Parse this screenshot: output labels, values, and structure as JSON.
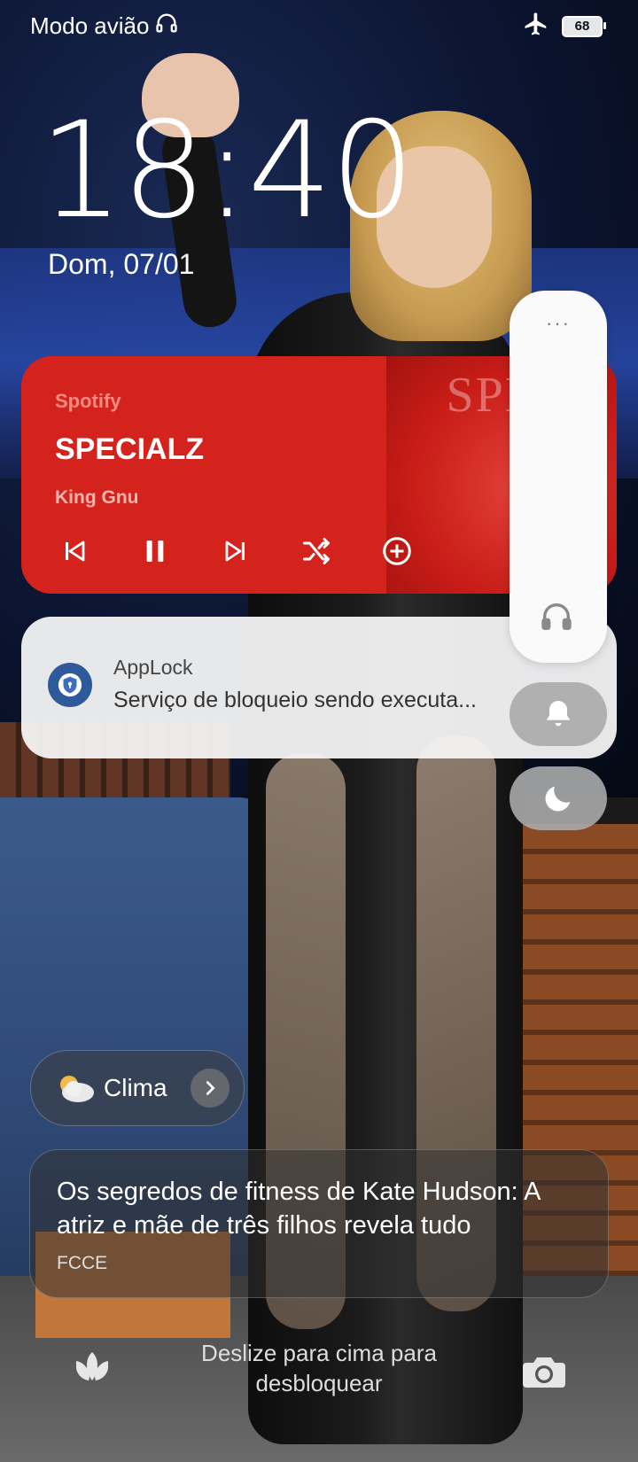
{
  "status_bar": {
    "mode_label": "Modo avião",
    "battery": "68",
    "icons": [
      "headphones-icon",
      "airplane-icon",
      "battery-icon"
    ]
  },
  "clock": {
    "time": "18:40",
    "date": "Dom, 07/01"
  },
  "media": {
    "app": "Spotify",
    "title": "SPECIALZ",
    "artist": "King Gnu",
    "art_text": "SPECI",
    "accent": "#d4221d",
    "controls": [
      "previous-icon",
      "pause-icon",
      "next-icon",
      "shuffle-icon",
      "add-icon"
    ]
  },
  "notification": {
    "app": "AppLock",
    "text": "Serviço de bloqueio sendo executa..."
  },
  "volume_panel": {
    "more_label": "···",
    "icons": [
      "headphones-icon",
      "bell-icon",
      "moon-icon"
    ]
  },
  "weather": {
    "label": "Clima",
    "icon": "cloud-icon"
  },
  "news": {
    "title": "Os segredos de fitness de Kate Hudson: A atriz e mãe de três filhos revela tudo",
    "source": "FCCE"
  },
  "bottom": {
    "unlock_hint": "Deslize para cima para desbloquear",
    "left_icon": "lotus-icon",
    "right_icon": "camera-icon"
  }
}
